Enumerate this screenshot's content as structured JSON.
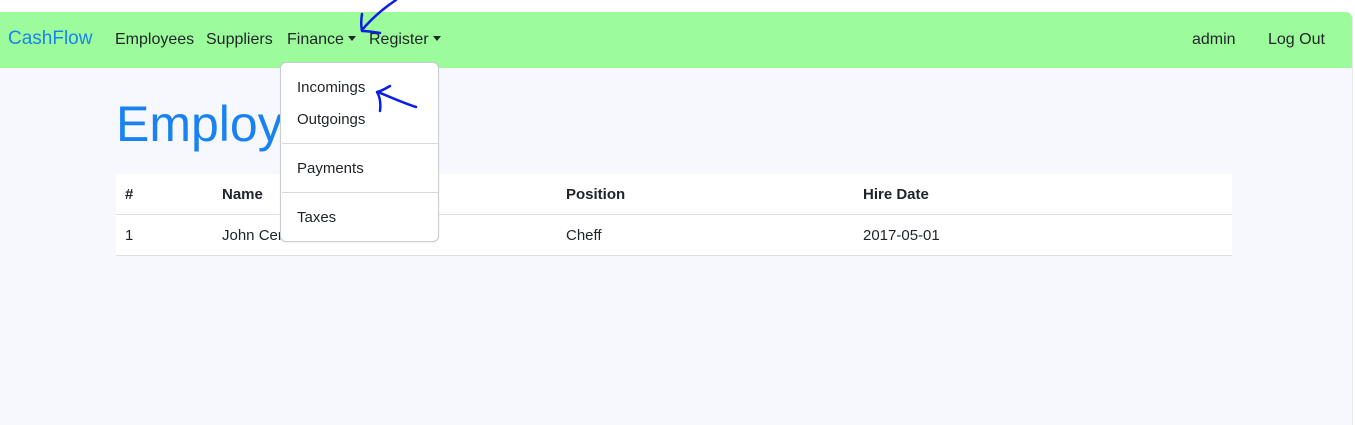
{
  "navbar": {
    "brand": "CashFlow",
    "items": [
      {
        "label": "Employees"
      },
      {
        "label": "Suppliers"
      },
      {
        "label": "Finance"
      },
      {
        "label": "Register"
      }
    ],
    "user": "admin",
    "logout": "Log Out",
    "background_color": "#9cfc9c",
    "brand_color": "#1a82f0"
  },
  "page": {
    "title": "Employees"
  },
  "table": {
    "headers": [
      "#",
      "Name",
      "Position",
      "Hire Date"
    ],
    "rows": [
      [
        "1",
        "John Cena",
        "Cheff",
        "2017-05-01"
      ]
    ]
  },
  "finance_menu": {
    "items": [
      {
        "label": "Incomings"
      },
      {
        "label": "Outgoings"
      },
      {
        "label": "Payments"
      },
      {
        "label": "Taxes"
      }
    ]
  },
  "annotation": {
    "color": "#0a1ee6",
    "icons": [
      "hand-drawn-arrow-icon",
      "hand-drawn-arrow-icon"
    ]
  }
}
